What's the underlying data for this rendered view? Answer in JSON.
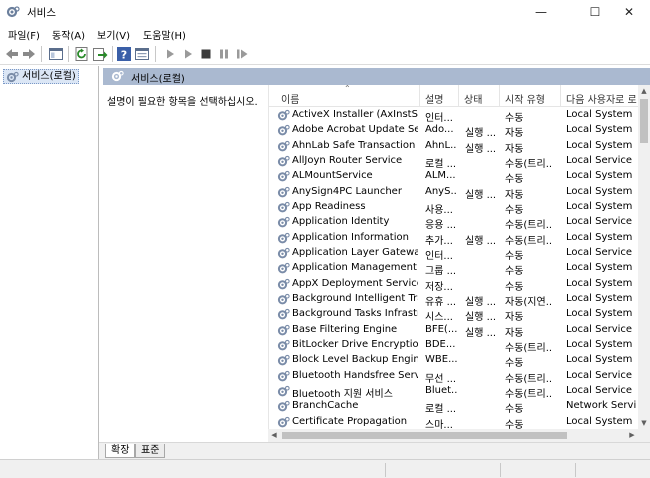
{
  "window": {
    "title": "서비스",
    "minimize_glyph": "—",
    "maximize_glyph": "☐",
    "close_glyph": "✕"
  },
  "menu": [
    {
      "label": "파일(F)"
    },
    {
      "label": "동작(A)"
    },
    {
      "label": "보기(V)"
    },
    {
      "label": "도움말(H)"
    }
  ],
  "toolbar": {
    "icons": [
      "back-icon",
      "forward-icon",
      "show-hide-tree-icon",
      "refresh-icon",
      "export-list-icon",
      "help-icon",
      "properties-icon",
      "start-service-icon",
      "start-service-alt-icon",
      "stop-service-icon",
      "pause-service-icon",
      "restart-service-icon"
    ]
  },
  "tree": {
    "items": [
      {
        "label": "서비스(로컬)"
      }
    ]
  },
  "pane": {
    "title": "서비스(로컬)",
    "description": "설명이 필요한 항목을 선택하십시오."
  },
  "columns": {
    "name": "이름",
    "description": "설명",
    "status": "상태",
    "startup_type": "시작 유형",
    "logon_as": "다음 사용자로 로"
  },
  "services": [
    {
      "name": "ActiveX Installer (AxInstSV)",
      "description": "인터...",
      "status": "",
      "startup": "수동",
      "logon": "Local System"
    },
    {
      "name": "Adobe Acrobat Update Ser...",
      "description": "Ado...",
      "status": "실행 ...",
      "startup": "자동",
      "logon": "Local System"
    },
    {
      "name": "AhnLab Safe Transaction S...",
      "description": "AhnL...",
      "status": "실행 ...",
      "startup": "자동",
      "logon": "Local System"
    },
    {
      "name": "AllJoyn Router Service",
      "description": "로컬 ...",
      "status": "",
      "startup": "수동(트리...",
      "logon": "Local Service"
    },
    {
      "name": "ALMountService",
      "description": "ALM...",
      "status": "",
      "startup": "수동",
      "logon": "Local System"
    },
    {
      "name": "AnySign4PC Launcher",
      "description": "AnyS...",
      "status": "실행 ...",
      "startup": "자동",
      "logon": "Local System"
    },
    {
      "name": "App Readiness",
      "description": "사용...",
      "status": "",
      "startup": "수동",
      "logon": "Local System"
    },
    {
      "name": "Application Identity",
      "description": "응용 ...",
      "status": "",
      "startup": "수동(트리...",
      "logon": "Local Service"
    },
    {
      "name": "Application Information",
      "description": "추가...",
      "status": "실행 ...",
      "startup": "수동(트리...",
      "logon": "Local System"
    },
    {
      "name": "Application Layer Gateway ...",
      "description": "인터...",
      "status": "",
      "startup": "수동",
      "logon": "Local Service"
    },
    {
      "name": "Application Management",
      "description": "그룹 ...",
      "status": "",
      "startup": "수동",
      "logon": "Local System"
    },
    {
      "name": "AppX Deployment Service ...",
      "description": "저장...",
      "status": "",
      "startup": "수동",
      "logon": "Local System"
    },
    {
      "name": "Background Intelligent Tra...",
      "description": "유휴 ...",
      "status": "실행 ...",
      "startup": "자동(지연...",
      "logon": "Local System"
    },
    {
      "name": "Background Tasks Infrastru...",
      "description": "시스...",
      "status": "실행 ...",
      "startup": "자동",
      "logon": "Local System"
    },
    {
      "name": "Base Filtering Engine",
      "description": "BFE(...",
      "status": "실행 ...",
      "startup": "자동",
      "logon": "Local Service"
    },
    {
      "name": "BitLocker Drive Encryption ...",
      "description": "BDE...",
      "status": "",
      "startup": "수동(트리...",
      "logon": "Local System"
    },
    {
      "name": "Block Level Backup Engine ...",
      "description": "WBE...",
      "status": "",
      "startup": "수동",
      "logon": "Local System"
    },
    {
      "name": "Bluetooth Handsfree Service",
      "description": "무선 ...",
      "status": "",
      "startup": "수동(트리...",
      "logon": "Local Service"
    },
    {
      "name": "Bluetooth 지원 서비스",
      "description": "Bluet...",
      "status": "",
      "startup": "수동(트리...",
      "logon": "Local Service"
    },
    {
      "name": "BranchCache",
      "description": "로컬 ...",
      "status": "",
      "startup": "수동",
      "logon": "Network Service"
    },
    {
      "name": "Certificate Propagation",
      "description": "스마...",
      "status": "",
      "startup": "수동",
      "logon": "Local System"
    }
  ],
  "tabs": [
    {
      "label": "확장",
      "active": true
    },
    {
      "label": "표준",
      "active": false
    }
  ],
  "scroll": {
    "up": "▲",
    "down": "▼",
    "left": "◀",
    "right": "▶"
  },
  "colors": {
    "pane_header_bg": "#aab9d0",
    "tree_selection_bg": "#dbe6f5",
    "toolbar_green": "#2a8a2a",
    "gear_icon": "#7a8ca8"
  }
}
